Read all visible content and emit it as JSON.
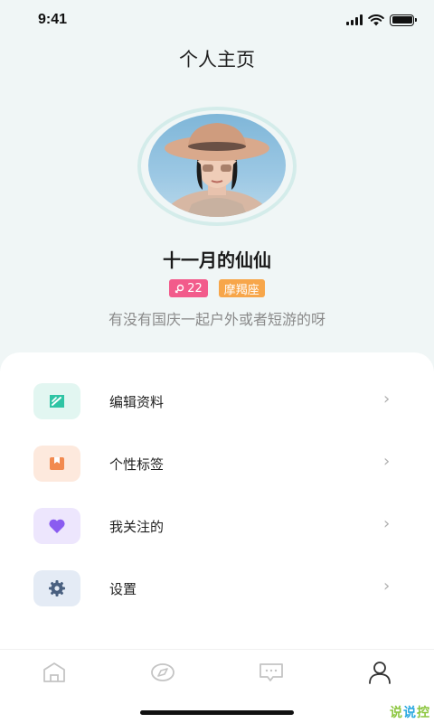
{
  "status_bar": {
    "time": "9:41"
  },
  "page": {
    "title": "个人主页"
  },
  "profile": {
    "name": "十一月的仙仙",
    "age_tag": "22",
    "zodiac_tag": "摩羯座",
    "bio": "有没有国庆一起户外或者短游的呀"
  },
  "menu": {
    "items": [
      {
        "label": "编辑资料",
        "icon": "edit-icon",
        "color": "#2fc4a4",
        "bg": "#e2f6f1"
      },
      {
        "label": "个性标签",
        "icon": "bookmark-icon",
        "color": "#f28a4f",
        "bg": "#fde9dd"
      },
      {
        "label": "我关注的",
        "icon": "heart-icon",
        "color": "#8a5cf0",
        "bg": "#ede6fd"
      },
      {
        "label": "设置",
        "icon": "gear-icon",
        "color": "#4a6080",
        "bg": "#e4ebf5"
      }
    ]
  },
  "tabs": [
    {
      "name": "home",
      "icon": "home-icon"
    },
    {
      "name": "discover",
      "icon": "compass-icon"
    },
    {
      "name": "messages",
      "icon": "chat-icon"
    },
    {
      "name": "profile",
      "icon": "user-icon",
      "active": true
    }
  ],
  "watermark": {
    "c1": "说",
    "c2": "说",
    "c3": "控"
  }
}
